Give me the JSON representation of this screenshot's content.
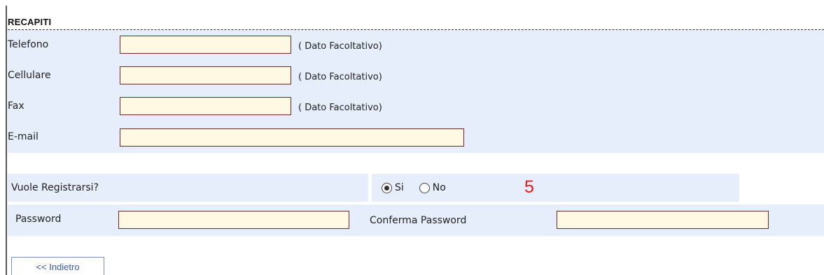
{
  "contacts": {
    "section_title": "RECAPITI",
    "phone": {
      "label": "Telefono",
      "value": "",
      "note": "( Dato Facoltativo)"
    },
    "mobile": {
      "label": "Cellulare",
      "value": "",
      "note": "( Dato Facoltativo)"
    },
    "fax": {
      "label": "Fax",
      "value": "",
      "note": "( Dato Facoltativo)"
    },
    "email": {
      "label": "E-mail",
      "value": ""
    }
  },
  "registration": {
    "question": "Vuole Registrarsi?",
    "options": [
      {
        "label": "Si",
        "selected": true
      },
      {
        "label": "No",
        "selected": false
      }
    ],
    "step_marker": "5"
  },
  "password": {
    "label": "Password",
    "value": "",
    "confirm_label": "Conferma Password",
    "confirm_value": ""
  },
  "navigation": {
    "back_label": "<< Indietro"
  },
  "colors": {
    "panel_background": "#e7eefb",
    "input_background": "#fff9e3",
    "input_border": "#6b2a2a",
    "step_marker": "#e21b1b",
    "back_link": "#3858a8"
  }
}
